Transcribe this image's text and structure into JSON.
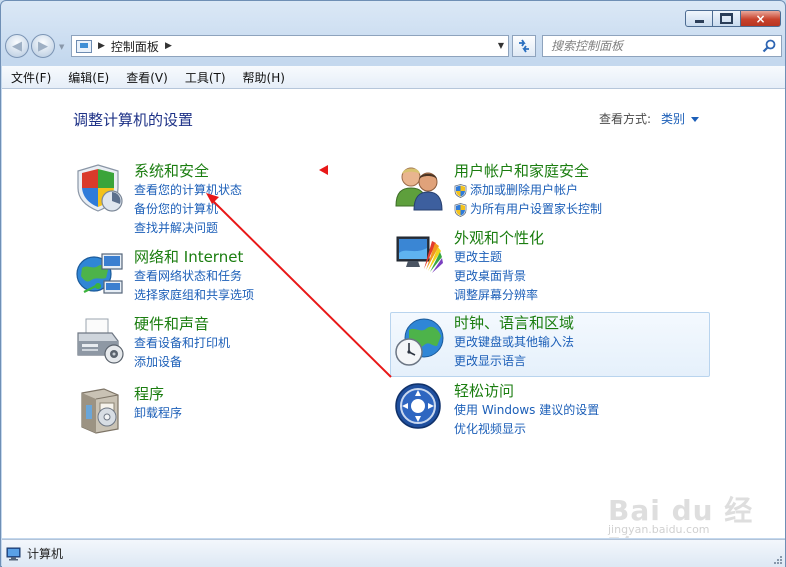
{
  "window": {
    "caption_close": "×"
  },
  "navbar": {
    "breadcrumb": [
      "控制面板"
    ],
    "search_placeholder": "搜索控制面板"
  },
  "menu": [
    "文件(F)",
    "编辑(E)",
    "查看(V)",
    "工具(T)",
    "帮助(H)"
  ],
  "content": {
    "title": "调整计算机的设置",
    "view_by_label": "查看方式:",
    "view_by_value": "类别"
  },
  "categories": [
    {
      "id": "system-security",
      "title": "系统和安全",
      "icon": "shield-icon",
      "links": [
        "查看您的计算机状态",
        "备份您的计算机",
        "查找并解决问题"
      ],
      "link_shields": [
        false,
        false,
        false
      ]
    },
    {
      "id": "network-internet",
      "title": "网络和 Internet",
      "icon": "network-globe-icon",
      "links": [
        "查看网络状态和任务",
        "选择家庭组和共享选项"
      ],
      "link_shields": [
        false,
        false
      ]
    },
    {
      "id": "hardware-sound",
      "title": "硬件和声音",
      "icon": "printer-icon",
      "links": [
        "查看设备和打印机",
        "添加设备"
      ],
      "link_shields": [
        false,
        false
      ]
    },
    {
      "id": "programs",
      "title": "程序",
      "icon": "programs-box-icon",
      "links": [
        "卸载程序"
      ],
      "link_shields": [
        false
      ]
    },
    {
      "id": "user-accounts",
      "title": "用户帐户和家庭安全",
      "icon": "users-icon",
      "links": [
        "添加或删除用户帐户",
        "为所有用户设置家长控制"
      ],
      "link_shields": [
        true,
        true
      ]
    },
    {
      "id": "appearance",
      "title": "外观和个性化",
      "icon": "monitor-palette-icon",
      "links": [
        "更改主题",
        "更改桌面背景",
        "调整屏幕分辨率"
      ],
      "link_shields": [
        false,
        false,
        false
      ]
    },
    {
      "id": "clock-region",
      "title": "时钟、语言和区域",
      "icon": "globe-clock-icon",
      "links": [
        "更改键盘或其他输入法",
        "更改显示语言"
      ],
      "link_shields": [
        false,
        false
      ]
    },
    {
      "id": "ease-of-access",
      "title": "轻松访问",
      "icon": "ease-of-access-icon",
      "links": [
        "使用 Windows 建议的设置",
        "优化视频显示"
      ],
      "link_shields": [
        false,
        false
      ]
    }
  ],
  "annotation": {
    "color": "#e81818"
  },
  "watermark": {
    "brand": "Bai du 经验",
    "site": "jingyan.baidu.com"
  },
  "statusbar": {
    "text": "计算机"
  },
  "colors": {
    "category_title": "#1a7d0f",
    "link": "#1c5fb8",
    "page_title": "#1e3287"
  }
}
